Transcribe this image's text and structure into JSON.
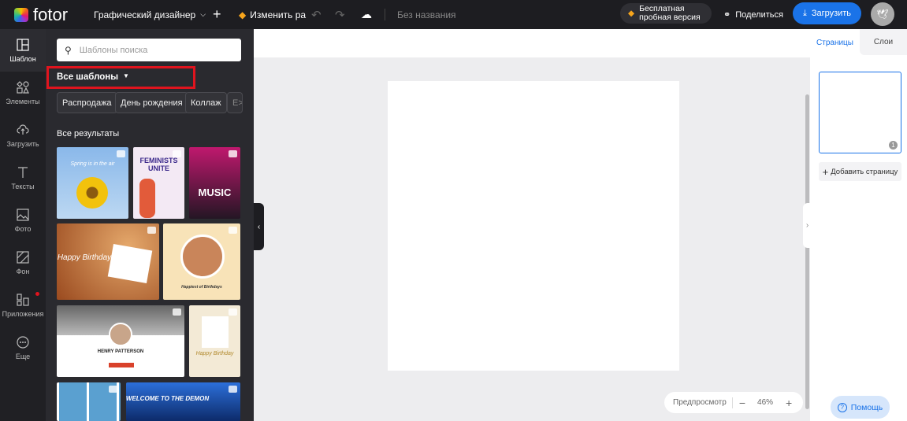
{
  "topbar": {
    "logo": "fotor",
    "mode": "Графический дизайнер",
    "resize": "Изменить ра",
    "doc_title": "Без названия",
    "trial": [
      "Бесплатная",
      "пробная версия"
    ],
    "share": "Поделиться",
    "download": "Загрузить"
  },
  "rail": [
    {
      "label": "Шаблон",
      "icon": "template-icon"
    },
    {
      "label": "Элементы",
      "icon": "elements-icon"
    },
    {
      "label": "Загрузить",
      "icon": "upload-icon"
    },
    {
      "label": "Тексты",
      "icon": "text-icon"
    },
    {
      "label": "Фото",
      "icon": "photo-icon"
    },
    {
      "label": "Фон",
      "icon": "background-icon"
    },
    {
      "label": "Приложения",
      "icon": "apps-icon"
    },
    {
      "label": "Еще",
      "icon": "more-icon"
    }
  ],
  "panel": {
    "search_placeholder": "Шаблоны поиска",
    "filter": "Все шаблоны",
    "chips": [
      "Распродажа",
      "День рождения",
      "Коллаж",
      "E>"
    ],
    "results_title": "Все результаты",
    "templates": [
      {
        "text": "Spring is in the air"
      },
      {
        "text": "FEMINISTS UNITE"
      },
      {
        "text": "MUSIC"
      },
      {
        "text": "Happy Birthday"
      },
      {
        "text": "Happiest of Birthdays"
      },
      {
        "text": "HENRY PATTERSON"
      },
      {
        "text": "Happy Birthday"
      },
      {
        "text": ""
      },
      {
        "text": "WELCOME TO THE DEMON"
      }
    ]
  },
  "canvas": {
    "preview": "Предпросмотр",
    "zoom": "46%"
  },
  "right": {
    "tabs": [
      "Страницы",
      "Слои"
    ],
    "page_number": "1",
    "add_page": "Добавить страницу",
    "help": "Помощь"
  },
  "colors": {
    "accent": "#1a73e8",
    "highlight": "#e0141e"
  }
}
